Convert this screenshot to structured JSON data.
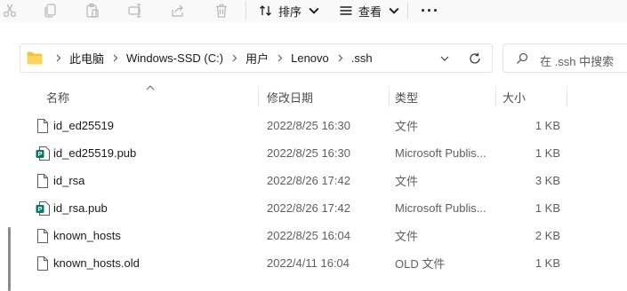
{
  "toolbar": {
    "icons": [
      "cut-icon",
      "copy-icon",
      "paste-icon",
      "rename-icon",
      "share-icon",
      "delete-icon"
    ],
    "sort_label": "排序",
    "view_label": "查看",
    "more_label": "···"
  },
  "address": {
    "crumbs": [
      "此电脑",
      "Windows-SSD (C:)",
      "用户",
      "Lenovo",
      ".ssh"
    ]
  },
  "search": {
    "placeholder": "在 .ssh 中搜索"
  },
  "columns": {
    "name": "名称",
    "date": "修改日期",
    "type": "类型",
    "size": "大小"
  },
  "files": [
    {
      "name": "id_ed25519",
      "date": "2022/8/25 16:30",
      "type": "文件",
      "size": "1 KB",
      "icon": "generic-file-icon"
    },
    {
      "name": "id_ed25519.pub",
      "date": "2022/8/25 16:30",
      "type": "Microsoft Publis...",
      "size": "1 KB",
      "icon": "publisher-file-icon"
    },
    {
      "name": "id_rsa",
      "date": "2022/8/26 17:42",
      "type": "文件",
      "size": "3 KB",
      "icon": "generic-file-icon"
    },
    {
      "name": "id_rsa.pub",
      "date": "2022/8/26 17:42",
      "type": "Microsoft Publis...",
      "size": "1 KB",
      "icon": "publisher-file-icon"
    },
    {
      "name": "known_hosts",
      "date": "2022/8/25 16:04",
      "type": "文件",
      "size": "2 KB",
      "icon": "generic-file-icon"
    },
    {
      "name": "known_hosts.old",
      "date": "2022/4/11 16:04",
      "type": "OLD 文件",
      "size": "1 KB",
      "icon": "generic-file-icon"
    }
  ],
  "colors": {
    "folder": "#f5c33b",
    "publisher": "#077568",
    "disabled_icon": "#b9b9b9"
  }
}
